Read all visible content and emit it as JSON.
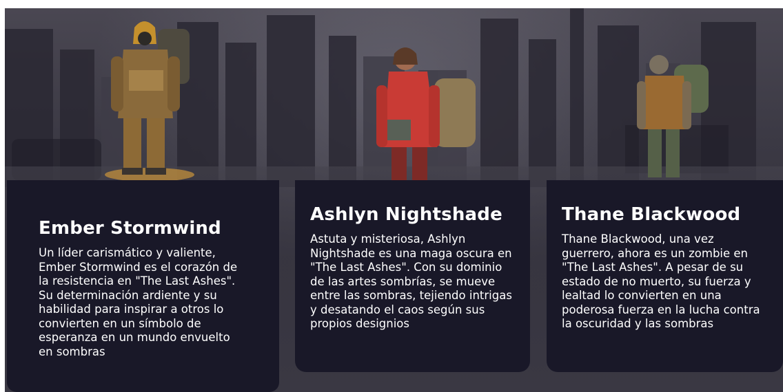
{
  "characters": [
    {
      "name": "Ember Stormwind",
      "description": "Un líder carismático y valiente, Ember Stormwind es el corazón de la resistencia en \"The Last Ashes\". Su determinación ardiente y su habilidad para inspirar a otros lo convierten en un símbolo de esperanza en un mundo envuelto en sombras"
    },
    {
      "name": "Ashlyn Nightshade",
      "description": "Astuta y misteriosa, Ashlyn Nightshade es una maga oscura en \"The Last Ashes\". Con su dominio de las artes sombrías, se mueve entre las sombras, tejiendo intrigas y desatando el caos según sus propios designios"
    },
    {
      "name": "Thane Blackwood",
      "description": "Thane Blackwood, una vez guerrero, ahora es un zombie en \"The Last Ashes\". A pesar de su estado de no muerto, su fuerza y lealtad lo convierten en una poderosa fuerza en la lucha contra la oscuridad y las sombras"
    }
  ],
  "colors": {
    "card_background": "#191828",
    "card_text": "#ffffff",
    "hero_background": "#3b3944"
  }
}
